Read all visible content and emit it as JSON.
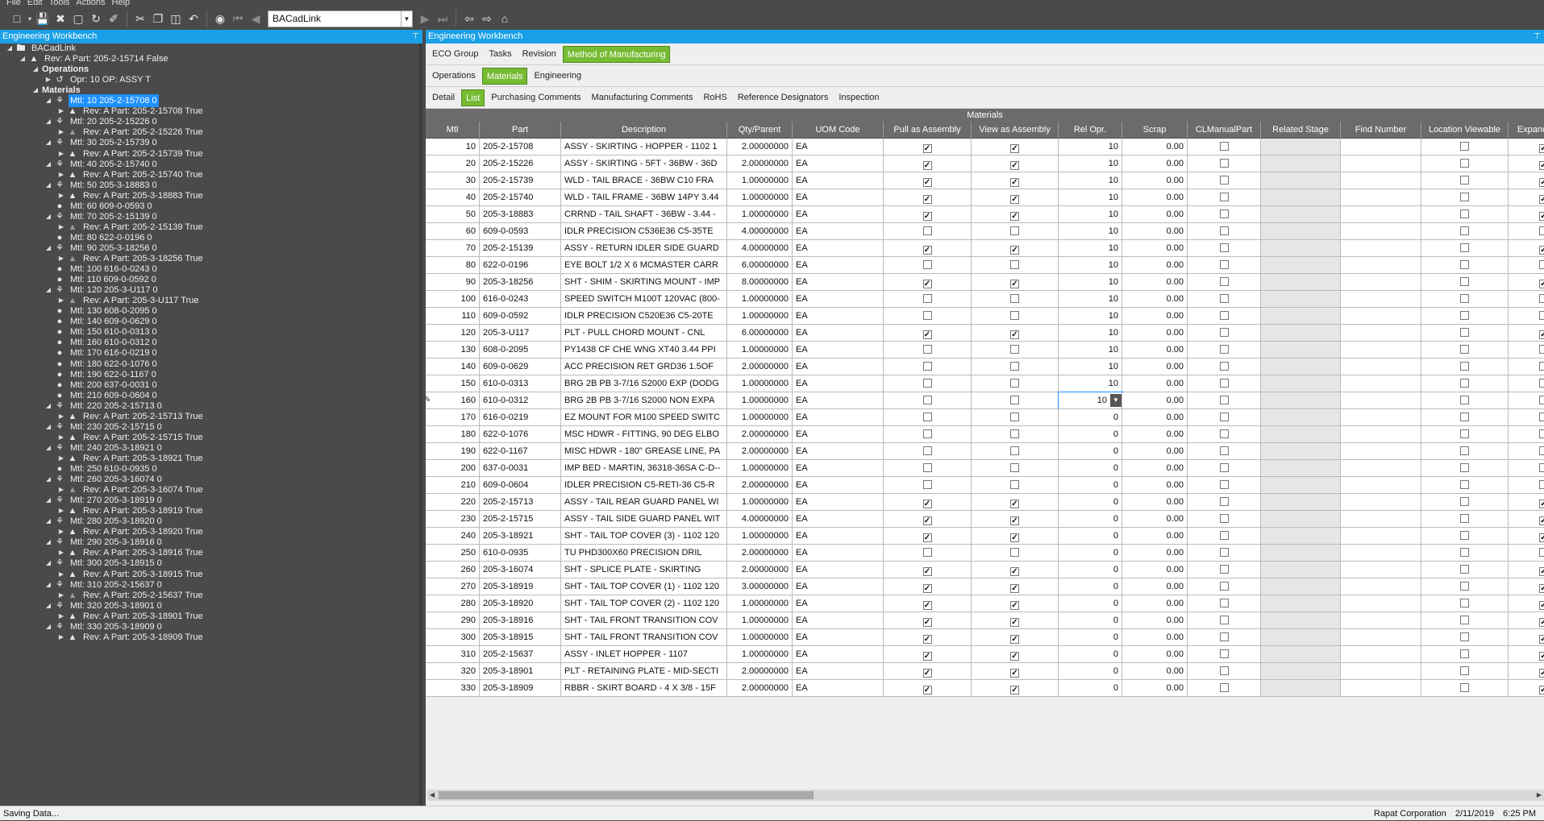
{
  "menu": [
    "File",
    "Edit",
    "Tools",
    "Actions",
    "Help"
  ],
  "toolbar": {
    "combo_value": "BACadLink"
  },
  "left_title": "Engineering Workbench",
  "right_title": "Engineering Workbench",
  "tree": [
    {
      "level": 0,
      "icon": "folder",
      "text": "BACadLink",
      "exp": "open"
    },
    {
      "level": 1,
      "icon": "warn",
      "text": "Rev: A Part: 205-2-15714 False",
      "exp": "open"
    },
    {
      "level": 2,
      "icon": "",
      "text": "Operations",
      "exp": "open",
      "bold": true
    },
    {
      "level": 3,
      "icon": "op",
      "text": "Opr: 10 OP: ASSY  T",
      "exp": "closed"
    },
    {
      "level": 2,
      "icon": "",
      "text": "Materials",
      "exp": "open",
      "bold": true
    },
    {
      "level": 3,
      "icon": "asm",
      "text": "Mtl: 10 205-2-15708 0",
      "exp": "open",
      "sel": true
    },
    {
      "level": 4,
      "icon": "warn",
      "text": "Rev: A Part: 205-2-15708 True",
      "exp": "closed"
    },
    {
      "level": 3,
      "icon": "asm",
      "text": "Mtl: 20 205-2-15226 0",
      "exp": "open"
    },
    {
      "level": 4,
      "icon": "warndim",
      "text": "Rev: A Part: 205-2-15226 True",
      "exp": "closed"
    },
    {
      "level": 3,
      "icon": "asm",
      "text": "Mtl: 30 205-2-15739 0",
      "exp": "open"
    },
    {
      "level": 4,
      "icon": "warn",
      "text": "Rev: A Part: 205-2-15739 True",
      "exp": "closed"
    },
    {
      "level": 3,
      "icon": "asm",
      "text": "Mtl: 40 205-2-15740 0",
      "exp": "open"
    },
    {
      "level": 4,
      "icon": "warn",
      "text": "Rev: A Part: 205-2-15740 True",
      "exp": "closed"
    },
    {
      "level": 3,
      "icon": "asm",
      "text": "Mtl: 50 205-3-18883 0",
      "exp": "open"
    },
    {
      "level": 4,
      "icon": "warn",
      "text": "Rev: A Part: 205-3-18883 True",
      "exp": "closed"
    },
    {
      "level": 3,
      "icon": "tag",
      "text": "Mtl: 60 609-0-0593 0",
      "exp": ""
    },
    {
      "level": 3,
      "icon": "asm",
      "text": "Mtl: 70 205-2-15139 0",
      "exp": "open"
    },
    {
      "level": 4,
      "icon": "warndim",
      "text": "Rev: A Part: 205-2-15139 True",
      "exp": "closed"
    },
    {
      "level": 3,
      "icon": "tag",
      "text": "Mtl: 80 622-0-0196 0",
      "exp": ""
    },
    {
      "level": 3,
      "icon": "asm",
      "text": "Mtl: 90 205-3-18256 0",
      "exp": "open"
    },
    {
      "level": 4,
      "icon": "warndim",
      "text": "Rev: A Part: 205-3-18256 True",
      "exp": "closed"
    },
    {
      "level": 3,
      "icon": "tag",
      "text": "Mtl: 100 616-0-0243 0",
      "exp": ""
    },
    {
      "level": 3,
      "icon": "tag",
      "text": "Mtl: 110 609-0-0592 0",
      "exp": ""
    },
    {
      "level": 3,
      "icon": "asm",
      "text": "Mtl: 120 205-3-U117 0",
      "exp": "open"
    },
    {
      "level": 4,
      "icon": "warndim",
      "text": "Rev: A Part: 205-3-U117 True",
      "exp": "closed"
    },
    {
      "level": 3,
      "icon": "tag",
      "text": "Mtl: 130 608-0-2095 0",
      "exp": ""
    },
    {
      "level": 3,
      "icon": "tag",
      "text": "Mtl: 140 609-0-0629 0",
      "exp": ""
    },
    {
      "level": 3,
      "icon": "tag",
      "text": "Mtl: 150 610-0-0313 0",
      "exp": ""
    },
    {
      "level": 3,
      "icon": "tag",
      "text": "Mtl: 160 610-0-0312 0",
      "exp": ""
    },
    {
      "level": 3,
      "icon": "tag",
      "text": "Mtl: 170 616-0-0219 0",
      "exp": ""
    },
    {
      "level": 3,
      "icon": "tag",
      "text": "Mtl: 180 622-0-1076 0",
      "exp": ""
    },
    {
      "level": 3,
      "icon": "tag",
      "text": "Mtl: 190 622-0-1167 0",
      "exp": ""
    },
    {
      "level": 3,
      "icon": "tag",
      "text": "Mtl: 200 637-0-0031 0",
      "exp": ""
    },
    {
      "level": 3,
      "icon": "tag",
      "text": "Mtl: 210 609-0-0604 0",
      "exp": ""
    },
    {
      "level": 3,
      "icon": "asm",
      "text": "Mtl: 220 205-2-15713 0",
      "exp": "open"
    },
    {
      "level": 4,
      "icon": "warn",
      "text": "Rev: A Part: 205-2-15713 True",
      "exp": "closed"
    },
    {
      "level": 3,
      "icon": "asm",
      "text": "Mtl: 230 205-2-15715 0",
      "exp": "open"
    },
    {
      "level": 4,
      "icon": "warn",
      "text": "Rev: A Part: 205-2-15715 True",
      "exp": "closed"
    },
    {
      "level": 3,
      "icon": "asm",
      "text": "Mtl: 240 205-3-18921 0",
      "exp": "open"
    },
    {
      "level": 4,
      "icon": "warn",
      "text": "Rev: A Part: 205-3-18921 True",
      "exp": "closed"
    },
    {
      "level": 3,
      "icon": "tag",
      "text": "Mtl: 250 610-0-0935 0",
      "exp": ""
    },
    {
      "level": 3,
      "icon": "asm",
      "text": "Mtl: 260 205-3-16074 0",
      "exp": "open"
    },
    {
      "level": 4,
      "icon": "warndim",
      "text": "Rev: A Part: 205-3-16074 True",
      "exp": "closed"
    },
    {
      "level": 3,
      "icon": "asm",
      "text": "Mtl: 270 205-3-18919 0",
      "exp": "open"
    },
    {
      "level": 4,
      "icon": "warn",
      "text": "Rev: A Part: 205-3-18919 True",
      "exp": "closed"
    },
    {
      "level": 3,
      "icon": "asm",
      "text": "Mtl: 280 205-3-18920 0",
      "exp": "open"
    },
    {
      "level": 4,
      "icon": "warn",
      "text": "Rev: A Part: 205-3-18920 True",
      "exp": "closed"
    },
    {
      "level": 3,
      "icon": "asm",
      "text": "Mtl: 290 205-3-18916 0",
      "exp": "open"
    },
    {
      "level": 4,
      "icon": "warn",
      "text": "Rev: A Part: 205-3-18916 True",
      "exp": "closed"
    },
    {
      "level": 3,
      "icon": "asm",
      "text": "Mtl: 300 205-3-18915 0",
      "exp": "open"
    },
    {
      "level": 4,
      "icon": "warn",
      "text": "Rev: A Part: 205-3-18915 True",
      "exp": "closed"
    },
    {
      "level": 3,
      "icon": "asm",
      "text": "Mtl: 310 205-2-15637 0",
      "exp": "open"
    },
    {
      "level": 4,
      "icon": "warndim",
      "text": "Rev: A Part: 205-2-15637 True",
      "exp": "closed"
    },
    {
      "level": 3,
      "icon": "asm",
      "text": "Mtl: 320 205-3-18901 0",
      "exp": "open"
    },
    {
      "level": 4,
      "icon": "warn",
      "text": "Rev: A Part: 205-3-18901 True",
      "exp": "closed"
    },
    {
      "level": 3,
      "icon": "asm",
      "text": "Mtl: 330 205-3-18909 0",
      "exp": "open"
    },
    {
      "level": 4,
      "icon": "warn",
      "text": "Rev: A Part: 205-3-18909 True",
      "exp": "closed"
    }
  ],
  "tabs_top": [
    {
      "label": "ECO Group",
      "active": false
    },
    {
      "label": "Tasks",
      "active": false
    },
    {
      "label": "Revision",
      "active": false
    },
    {
      "label": "Method of Manufacturing",
      "active": true
    }
  ],
  "tabs_mid": [
    {
      "label": "Operations",
      "active": false
    },
    {
      "label": "Materials",
      "active": true
    },
    {
      "label": "Engineering",
      "active": false
    }
  ],
  "tabs_low": [
    {
      "label": "Detail",
      "active": false
    },
    {
      "label": "List",
      "active": true
    },
    {
      "label": "Purchasing Comments",
      "active": false
    },
    {
      "label": "Manufacturing Comments",
      "active": false
    },
    {
      "label": "RoHS",
      "active": false
    },
    {
      "label": "Reference Designators",
      "active": false
    },
    {
      "label": "Inspection",
      "active": false
    }
  ],
  "grid_title": "Materials",
  "columns": [
    "Mtl",
    "Part",
    "Description",
    "Qty/Parent",
    "UOM Code",
    "Pull as Assembly",
    "View as Assembly",
    "Rel Opr.",
    "Scrap",
    "CLManualPart",
    "Related Stage",
    "Find Number",
    "Location Viewable",
    "Expand"
  ],
  "rows": [
    {
      "mtl": "10",
      "part": "205-2-15708",
      "desc": "ASSY - SKIRTING - HOPPER - 1102 1",
      "qty": "2.00000000",
      "uom": "EA",
      "pull": true,
      "view": true,
      "rel": "10",
      "scrap": "0.00",
      "exp": true
    },
    {
      "mtl": "20",
      "part": "205-2-15226",
      "desc": "ASSY - SKIRTING - 5FT - 36BW - 36D",
      "qty": "2.00000000",
      "uom": "EA",
      "pull": true,
      "view": true,
      "rel": "10",
      "scrap": "0.00",
      "exp": true
    },
    {
      "mtl": "30",
      "part": "205-2-15739",
      "desc": "WLD - TAIL BRACE - 36BW C10 FRA",
      "qty": "1.00000000",
      "uom": "EA",
      "pull": true,
      "view": true,
      "rel": "10",
      "scrap": "0.00",
      "exp": true
    },
    {
      "mtl": "40",
      "part": "205-2-15740",
      "desc": "WLD - TAIL FRAME - 36BW 14PY 3.44",
      "qty": "1.00000000",
      "uom": "EA",
      "pull": true,
      "view": true,
      "rel": "10",
      "scrap": "0.00",
      "exp": true
    },
    {
      "mtl": "50",
      "part": "205-3-18883",
      "desc": "CRRND - TAIL SHAFT - 36BW - 3.44 -",
      "qty": "1.00000000",
      "uom": "EA",
      "pull": true,
      "view": true,
      "rel": "10",
      "scrap": "0.00",
      "exp": true
    },
    {
      "mtl": "60",
      "part": "609-0-0593",
      "desc": "IDLR PRECISION  C536E36  C5-35TE",
      "qty": "4.00000000",
      "uom": "EA",
      "pull": false,
      "view": false,
      "rel": "10",
      "scrap": "0.00",
      "exp": false
    },
    {
      "mtl": "70",
      "part": "205-2-15139",
      "desc": "ASSY - RETURN IDLER SIDE GUARD",
      "qty": "4.00000000",
      "uom": "EA",
      "pull": true,
      "view": true,
      "rel": "10",
      "scrap": "0.00",
      "exp": true
    },
    {
      "mtl": "80",
      "part": "622-0-0196",
      "desc": "EYE BOLT 1/2 X 6 MCMASTER CARR",
      "qty": "6.00000000",
      "uom": "EA",
      "pull": false,
      "view": false,
      "rel": "10",
      "scrap": "0.00",
      "exp": false
    },
    {
      "mtl": "90",
      "part": "205-3-18256",
      "desc": "SHT - SHIM - SKIRTING MOUNT - IMP",
      "qty": "8.00000000",
      "uom": "EA",
      "pull": true,
      "view": true,
      "rel": "10",
      "scrap": "0.00",
      "exp": true
    },
    {
      "mtl": "100",
      "part": "616-0-0243",
      "desc": "SPEED SWITCH M100T 120VAC (800-",
      "qty": "1.00000000",
      "uom": "EA",
      "pull": false,
      "view": false,
      "rel": "10",
      "scrap": "0.00",
      "exp": false
    },
    {
      "mtl": "110",
      "part": "609-0-0592",
      "desc": "IDLR PRECISION  C520E36  C5-20TE",
      "qty": "1.00000000",
      "uom": "EA",
      "pull": false,
      "view": false,
      "rel": "10",
      "scrap": "0.00",
      "exp": false
    },
    {
      "mtl": "120",
      "part": "205-3-U117",
      "desc": "PLT - PULL CHORD MOUNT - CNL",
      "qty": "6.00000000",
      "uom": "EA",
      "pull": true,
      "view": true,
      "rel": "10",
      "scrap": "0.00",
      "exp": true
    },
    {
      "mtl": "130",
      "part": "608-0-2095",
      "desc": "PY1438 CF CHE WNG XT40 3.44 PPI",
      "qty": "1.00000000",
      "uom": "EA",
      "pull": false,
      "view": false,
      "rel": "10",
      "scrap": "0.00",
      "exp": false
    },
    {
      "mtl": "140",
      "part": "609-0-0629",
      "desc": "ACC PRECISION  RET GRD36 1.5OF",
      "qty": "2.00000000",
      "uom": "EA",
      "pull": false,
      "view": false,
      "rel": "10",
      "scrap": "0.00",
      "exp": false
    },
    {
      "mtl": "150",
      "part": "610-0-0313",
      "desc": "BRG 2B PB 3-7/16 S2000 EXP (DODG",
      "qty": "1.00000000",
      "uom": "EA",
      "pull": false,
      "view": false,
      "rel": "10",
      "scrap": "0.00",
      "exp": false
    },
    {
      "mtl": "160",
      "part": "610-0-0312",
      "desc": "BRG 2B PB 3-7/16 S2000 NON EXPA",
      "qty": "1.00000000",
      "uom": "EA",
      "pull": false,
      "view": false,
      "rel": "10",
      "scrap": "0.00",
      "exp": false,
      "editing": true
    },
    {
      "mtl": "170",
      "part": "616-0-0219",
      "desc": "EZ MOUNT FOR M100 SPEED SWITC",
      "qty": "1.00000000",
      "uom": "EA",
      "pull": false,
      "view": false,
      "rel": "0",
      "scrap": "0.00",
      "exp": false
    },
    {
      "mtl": "180",
      "part": "622-0-1076",
      "desc": "MSC HDWR - FITTING, 90 DEG ELBO",
      "qty": "2.00000000",
      "uom": "EA",
      "pull": false,
      "view": false,
      "rel": "0",
      "scrap": "0.00",
      "exp": false
    },
    {
      "mtl": "190",
      "part": "622-0-1167",
      "desc": "MISC HDWR - 180\" GREASE LINE, PA",
      "qty": "2.00000000",
      "uom": "EA",
      "pull": false,
      "view": false,
      "rel": "0",
      "scrap": "0.00",
      "exp": false
    },
    {
      "mtl": "200",
      "part": "637-0-0031",
      "desc": "IMP BED - MARTIN, 36318-36SA C-D--",
      "qty": "1.00000000",
      "uom": "EA",
      "pull": false,
      "view": false,
      "rel": "0",
      "scrap": "0.00",
      "exp": false
    },
    {
      "mtl": "210",
      "part": "609-0-0604",
      "desc": "IDLER PRECISION C5-RETI-36  C5-R",
      "qty": "2.00000000",
      "uom": "EA",
      "pull": false,
      "view": false,
      "rel": "0",
      "scrap": "0.00",
      "exp": false
    },
    {
      "mtl": "220",
      "part": "205-2-15713",
      "desc": "ASSY - TAIL REAR GUARD PANEL WI",
      "qty": "1.00000000",
      "uom": "EA",
      "pull": true,
      "view": true,
      "rel": "0",
      "scrap": "0.00",
      "exp": true
    },
    {
      "mtl": "230",
      "part": "205-2-15715",
      "desc": "ASSY - TAIL SIDE GUARD PANEL WIT",
      "qty": "4.00000000",
      "uom": "EA",
      "pull": true,
      "view": true,
      "rel": "0",
      "scrap": "0.00",
      "exp": true
    },
    {
      "mtl": "240",
      "part": "205-3-18921",
      "desc": "SHT - TAIL TOP COVER (3) - 1102 120",
      "qty": "1.00000000",
      "uom": "EA",
      "pull": true,
      "view": true,
      "rel": "0",
      "scrap": "0.00",
      "exp": true
    },
    {
      "mtl": "250",
      "part": "610-0-0935",
      "desc": "TU    PHD300X60  PRECISION    DRIL",
      "qty": "2.00000000",
      "uom": "EA",
      "pull": false,
      "view": false,
      "rel": "0",
      "scrap": "0.00",
      "exp": false
    },
    {
      "mtl": "260",
      "part": "205-3-16074",
      "desc": "SHT - SPLICE PLATE - SKIRTING",
      "qty": "2.00000000",
      "uom": "EA",
      "pull": true,
      "view": true,
      "rel": "0",
      "scrap": "0.00",
      "exp": true
    },
    {
      "mtl": "270",
      "part": "205-3-18919",
      "desc": "SHT - TAIL TOP COVER (1) - 1102 120",
      "qty": "3.00000000",
      "uom": "EA",
      "pull": true,
      "view": true,
      "rel": "0",
      "scrap": "0.00",
      "exp": true
    },
    {
      "mtl": "280",
      "part": "205-3-18920",
      "desc": "SHT - TAIL TOP COVER (2) - 1102 120",
      "qty": "1.00000000",
      "uom": "EA",
      "pull": true,
      "view": true,
      "rel": "0",
      "scrap": "0.00",
      "exp": true
    },
    {
      "mtl": "290",
      "part": "205-3-18916",
      "desc": "SHT - TAIL FRONT TRANSITION COV",
      "qty": "1.00000000",
      "uom": "EA",
      "pull": true,
      "view": true,
      "rel": "0",
      "scrap": "0.00",
      "exp": true
    },
    {
      "mtl": "300",
      "part": "205-3-18915",
      "desc": "SHT - TAIL FRONT TRANSITION COV",
      "qty": "1.00000000",
      "uom": "EA",
      "pull": true,
      "view": true,
      "rel": "0",
      "scrap": "0.00",
      "exp": true
    },
    {
      "mtl": "310",
      "part": "205-2-15637",
      "desc": "ASSY - INLET HOPPER - 1107",
      "qty": "1.00000000",
      "uom": "EA",
      "pull": true,
      "view": true,
      "rel": "0",
      "scrap": "0.00",
      "exp": true
    },
    {
      "mtl": "320",
      "part": "205-3-18901",
      "desc": "PLT - RETAINING PLATE - MID-SECTI",
      "qty": "2.00000000",
      "uom": "EA",
      "pull": true,
      "view": true,
      "rel": "0",
      "scrap": "0.00",
      "exp": true
    },
    {
      "mtl": "330",
      "part": "205-3-18909",
      "desc": "RBBR - SKIRT BOARD - 4 X 3/8 - 15F",
      "qty": "2.00000000",
      "uom": "EA",
      "pull": true,
      "view": true,
      "rel": "0",
      "scrap": "0.00",
      "exp": true
    }
  ],
  "status": {
    "left": "Saving Data...",
    "company": "Rapat Corporation",
    "date": "2/11/2019",
    "time": "6:25 PM"
  }
}
